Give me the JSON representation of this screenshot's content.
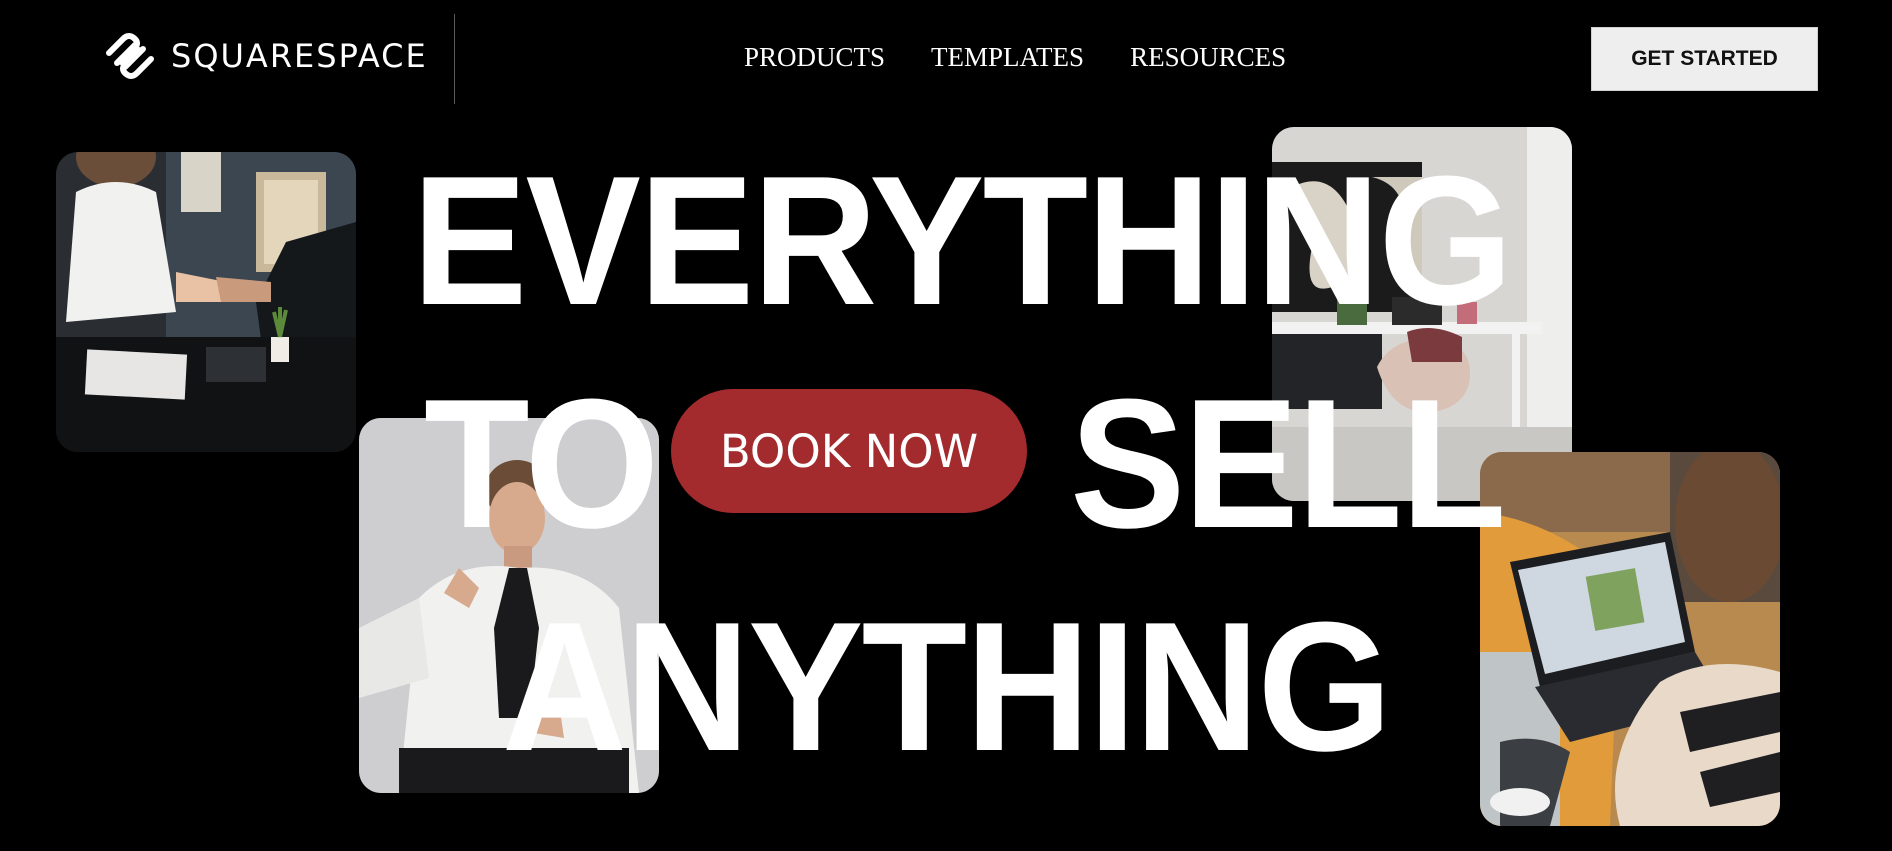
{
  "header": {
    "logo_text": "SQUARESPACE",
    "logo_icon": "squarespace-logo-icon",
    "nav": [
      {
        "label": "PRODUCTS"
      },
      {
        "label": "TEMPLATES"
      },
      {
        "label": "RESOURCES"
      }
    ],
    "cta_label": "GET STARTED"
  },
  "hero": {
    "line1": "EVERYTHING",
    "line2_left": "TO",
    "line2_right": "SELL",
    "line3": "ANYTHING",
    "button_label": "BOOK NOW",
    "button_color": "#a32a2d",
    "images": [
      {
        "name": "handshake-photo"
      },
      {
        "name": "office-desk-photo"
      },
      {
        "name": "man-tie-photo"
      },
      {
        "name": "woman-laptop-photo"
      }
    ]
  },
  "colors": {
    "background": "#000000",
    "text": "#ffffff",
    "cta_background": "#eeeeee"
  }
}
